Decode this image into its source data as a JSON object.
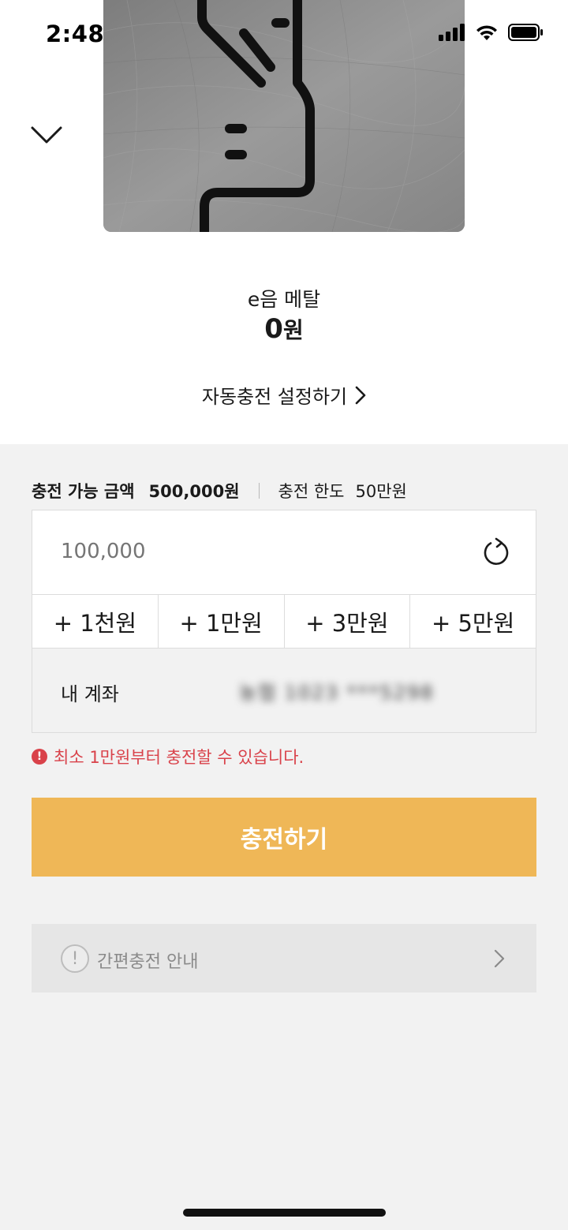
{
  "status_bar": {
    "time": "2:48"
  },
  "card": {
    "name": "e음 메탈",
    "balance_value": "0",
    "balance_unit": "원",
    "auto_charge_label": "자동충전 설정하기"
  },
  "limits": {
    "available_label": "충전 가능 금액",
    "available_value": "500,000원",
    "limit_label": "충전 한도",
    "limit_value": "50만원"
  },
  "charge": {
    "amount_placeholder": "100,000",
    "quick_buttons": [
      "+ 1천원",
      "+ 1만원",
      "+ 3만원",
      "+ 5만원"
    ],
    "account_label": "내 계좌",
    "account_value": "농협 1023 ***5298"
  },
  "warning_text": "최소 1만원부터 충전할 수 있습니다.",
  "charge_button_label": "충전하기",
  "guide_label": "간편충전 안내",
  "colors": {
    "accent": "#efb757",
    "warning": "#d9424a",
    "background": "#f2f2f2"
  },
  "icons": [
    "chevron-down-icon",
    "refresh-icon",
    "warning-icon",
    "info-icon",
    "chevron-right-icon"
  ]
}
